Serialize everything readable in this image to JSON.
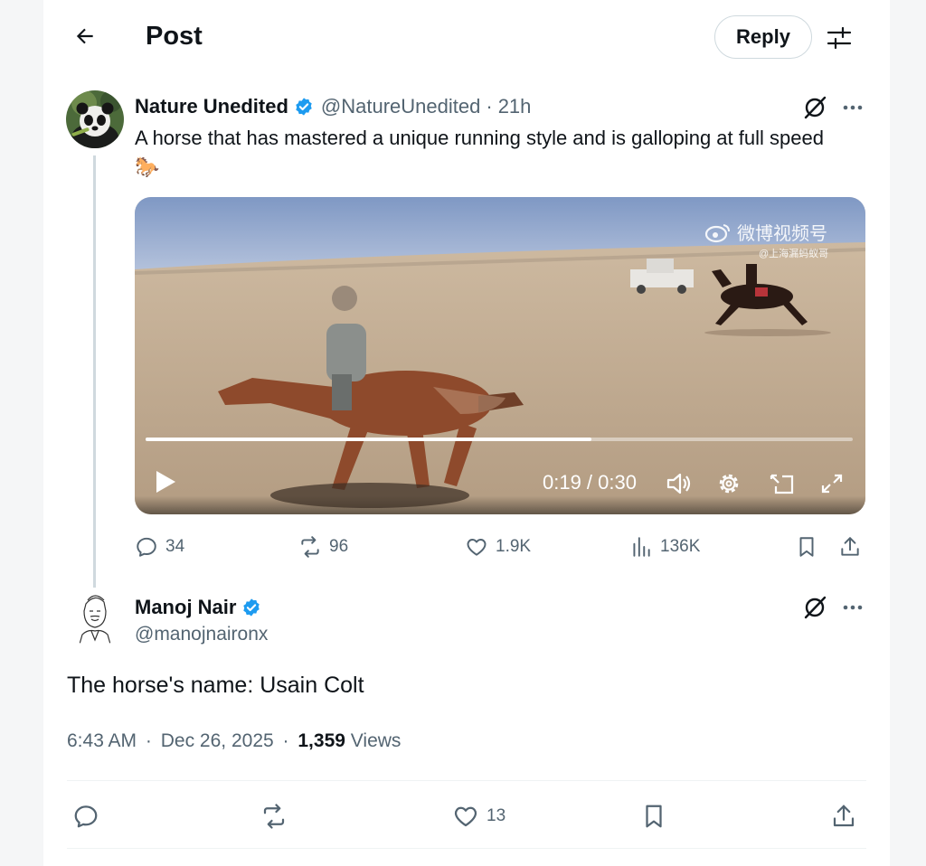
{
  "header": {
    "title": "Post",
    "reply_button": "Reply"
  },
  "original_post": {
    "author_name": "Nature Unedited",
    "handle": "@NatureUnedited",
    "separator": "·",
    "time_ago": "21h",
    "text": "A horse that has mastered a unique running style and is galloping at full speed 🐎",
    "video": {
      "watermark_main": "微博视频号",
      "watermark_sub": "@上海漏蚂蚁哥",
      "time_display": "0:19 / 0:30",
      "progress": 0.63
    },
    "stats": {
      "replies": "34",
      "reposts": "96",
      "likes": "1.9K",
      "views": "136K"
    }
  },
  "reply_post": {
    "author_name": "Manoj Nair",
    "handle": "@manojnaironx",
    "text": "The horse's name: Usain Colt",
    "time": "6:43 AM",
    "date": "Dec 26, 2025",
    "separator": "·",
    "views_count": "1,359",
    "views_label": "Views",
    "likes": "13"
  },
  "colors": {
    "verified": "#1d9bf0",
    "muted": "#536471",
    "border": "#cfd9de",
    "text": "#0f1419"
  },
  "icons": [
    "back-arrow-icon",
    "tune-icon",
    "verified-icon",
    "grok-icon",
    "more-icon",
    "play-icon",
    "volume-icon",
    "settings-icon",
    "pip-icon",
    "fullscreen-icon",
    "reply-icon",
    "repost-icon",
    "like-icon",
    "views-icon",
    "bookmark-icon",
    "share-icon"
  ]
}
